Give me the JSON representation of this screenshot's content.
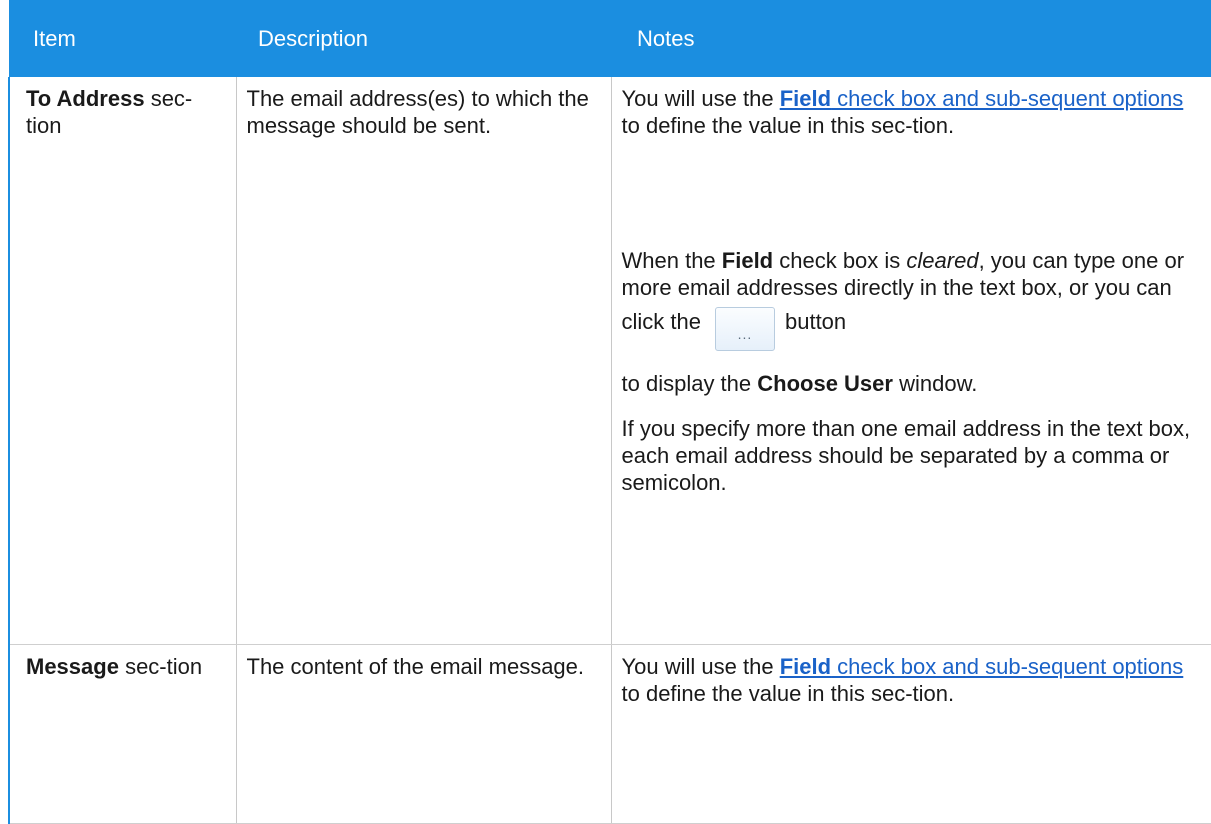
{
  "table": {
    "headers": [
      "Item",
      "Description",
      "Notes"
    ],
    "rows": [
      {
        "item": {
          "bold": "To Address",
          "rest": " sec-tion"
        },
        "description": "The email address(es) to which the message should be sent.",
        "notes": {
          "p1": {
            "pre": "You will use the ",
            "link_bold": "Field",
            "link_rest": " check box and sub-sequent options",
            "post": " to define the value in this sec-tion."
          },
          "p2": {
            "t1": "When the ",
            "b1": "Field",
            "t2": " check box is ",
            "i1": "cleared",
            "t3": ", you can type one or more email addresses directly in the text box, or you can click the",
            "button_label": "...",
            "t4": "button",
            "t5": "to display the ",
            "b2": "Choose User",
            "t6": " window."
          },
          "p3": "If you specify more than one email address in the text box, each email address should be separated by a comma or semicolon."
        }
      },
      {
        "item": {
          "bold": "Message",
          "rest": " sec-tion"
        },
        "description": "The content of the email message.",
        "notes": {
          "p1": {
            "pre": "You will use the ",
            "link_bold": "Field",
            "link_rest": " check box and sub-sequent options",
            "post": " to define the value in this sec-tion."
          }
        }
      }
    ]
  },
  "colors": {
    "header_bg": "#1b8ee0",
    "link": "#1a62c8"
  }
}
